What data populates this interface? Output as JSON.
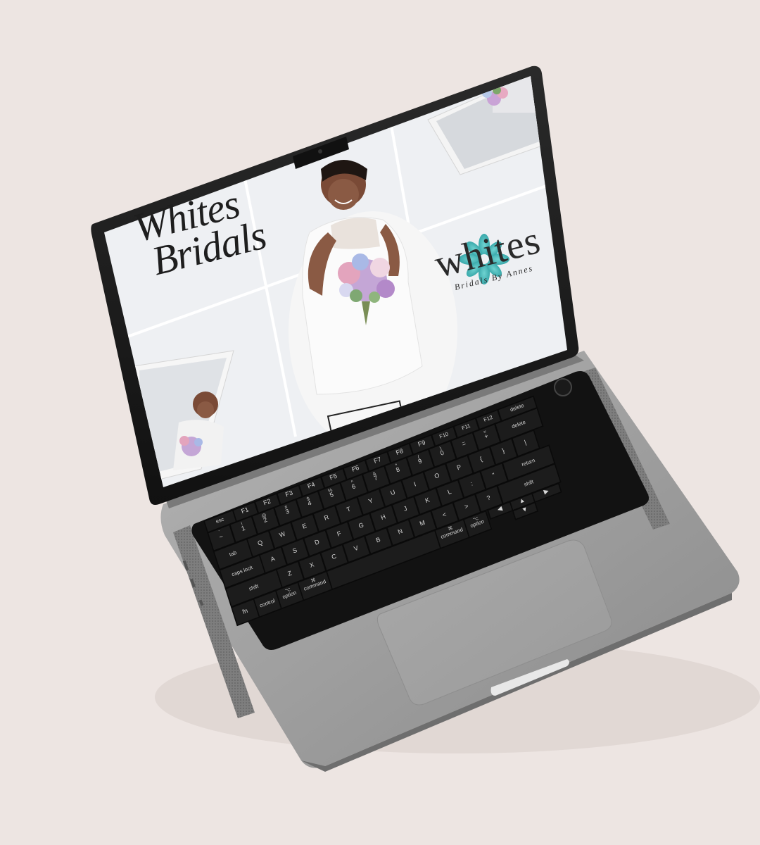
{
  "screen": {
    "brand_script_line1": "Whites",
    "brand_script_line2": "Bridals",
    "logo_word": "whites",
    "logo_tagline": "Bridals By Annes"
  },
  "keyboard": {
    "esc": "esc",
    "delete": "delete",
    "return": "return",
    "shift_right": "shift",
    "tab": "tab",
    "caps_lock": "caps lock",
    "shift_left": "shift",
    "fn": "fn",
    "control": "control",
    "option_left": "option",
    "command_left": "command",
    "command_right": "command",
    "option_right": "option",
    "command_symbol": "⌘",
    "option_symbol": "⌥",
    "row_function": [
      "F1",
      "F2",
      "F3",
      "F4",
      "F5",
      "F6",
      "F7",
      "F8",
      "F9",
      "F10",
      "F11",
      "F12"
    ],
    "row_numbers": [
      "~",
      "1",
      "2",
      "3",
      "4",
      "5",
      "6",
      "7",
      "8",
      "9",
      "0",
      "−",
      "+"
    ],
    "row_numbers_shift": [
      "`",
      "!",
      "@",
      "#",
      "$",
      "%",
      "^",
      "&",
      "*",
      "(",
      ")",
      "_",
      "="
    ],
    "row_q": [
      "Q",
      "W",
      "E",
      "R",
      "T",
      "Y",
      "U",
      "I",
      "O",
      "P",
      "{",
      "}",
      "|"
    ],
    "row_a": [
      "A",
      "S",
      "D",
      "F",
      "G",
      "H",
      "J",
      "K",
      "L",
      ":",
      "\""
    ],
    "row_z": [
      "Z",
      "X",
      "C",
      "V",
      "B",
      "N",
      "M",
      "<",
      ">",
      "?"
    ]
  },
  "colors": {
    "background": "#ede5e2",
    "chassis": "#9e9e9e",
    "keyboard_well": "#121212",
    "key": "#1c1c1c",
    "logo_teal": "#4fbfbf",
    "screen_bg": "#eef0f3"
  }
}
